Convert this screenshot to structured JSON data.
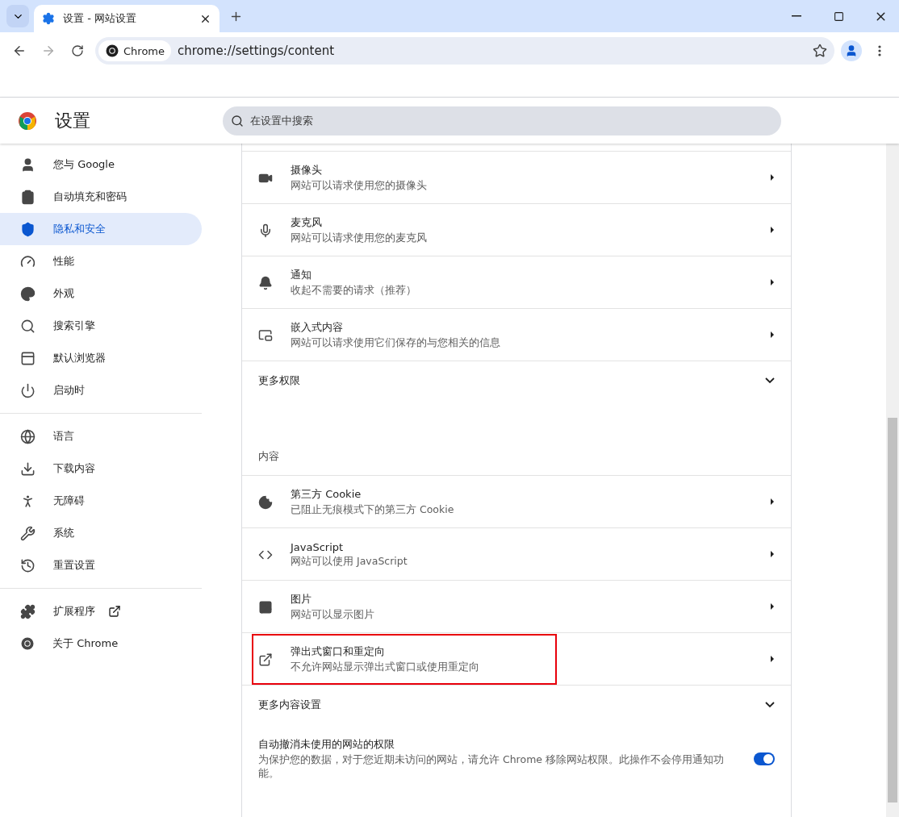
{
  "tabs": [
    {
      "title": "设置 - 网站设置",
      "selected": true
    }
  ],
  "address_bar": {
    "chip": "Chrome",
    "url": "chrome://settings/content"
  },
  "header": {
    "title": "设置",
    "search": {
      "placeholder": "在设置中搜索"
    }
  },
  "sidebar": {
    "groups": [
      {
        "items": [
          {
            "label": "您与 Google",
            "selected": false
          },
          {
            "label": "自动填充和密码",
            "selected": false
          },
          {
            "label": "隐私和安全",
            "selected": true
          },
          {
            "label": "性能",
            "selected": false
          },
          {
            "label": "外观",
            "selected": false
          },
          {
            "label": "搜索引擎",
            "selected": false
          },
          {
            "label": "默认浏览器",
            "selected": false
          },
          {
            "label": "启动时",
            "selected": false
          }
        ]
      },
      {
        "items": [
          {
            "label": "语言",
            "selected": false
          },
          {
            "label": "下载内容",
            "selected": false
          },
          {
            "label": "无障碍",
            "selected": false
          },
          {
            "label": "系统",
            "selected": false
          },
          {
            "label": "重置设置",
            "selected": false
          }
        ]
      },
      {
        "items": [
          {
            "label": "扩展程序",
            "selected": false,
            "external": true
          },
          {
            "label": "关于 Chrome",
            "selected": false,
            "external": false
          }
        ]
      }
    ]
  },
  "content": {
    "rows": [
      {
        "kind": "setting",
        "title": "摄像头",
        "subtitle": "网站可以请求使用您的摄像头",
        "highlighted": false
      },
      {
        "kind": "setting",
        "title": "麦克风",
        "subtitle": "网站可以请求使用您的麦克风",
        "highlighted": false
      },
      {
        "kind": "setting",
        "title": "通知",
        "subtitle": "收起不需要的请求（推荐）",
        "highlighted": false
      },
      {
        "kind": "setting",
        "title": "嵌入式内容",
        "subtitle": "网站可以请求使用它们保存的与您相关的信息",
        "highlighted": false
      },
      {
        "kind": "expand",
        "title": "更多权限",
        "expanded": false
      },
      {
        "kind": "heading",
        "title": "内容"
      },
      {
        "kind": "setting",
        "title": "第三方 Cookie",
        "subtitle": "已阻止无痕模式下的第三方 Cookie",
        "highlighted": false
      },
      {
        "kind": "setting",
        "title": "JavaScript",
        "subtitle": "网站可以使用 JavaScript",
        "highlighted": false
      },
      {
        "kind": "setting",
        "title": "图片",
        "subtitle": "网站可以显示图片",
        "highlighted": false
      },
      {
        "kind": "setting",
        "title": "弹出式窗口和重定向",
        "subtitle": "不允许网站显示弹出式窗口或使用重定向",
        "highlighted": true
      },
      {
        "kind": "expand",
        "title": "更多内容设置",
        "expanded": false
      },
      {
        "kind": "toggle",
        "title": "自动撤消未使用的网站的权限",
        "subtitle": "为保护您的数据，对于您近期未访问的网站，请允许 Chrome 移除网站权限。此操作不会停用通知功能。",
        "on": true
      }
    ]
  }
}
